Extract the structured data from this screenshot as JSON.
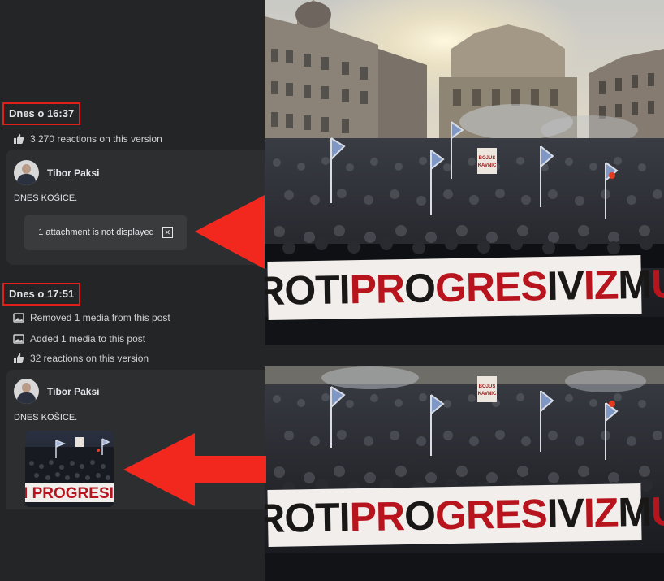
{
  "version1": {
    "timestamp": "Dnes o 16:37",
    "reactions_text": "3 270 reactions on this version",
    "author": "Tibor Paksi",
    "post_text": "DNES KOŠICE.",
    "attachment_notice": "1 attachment is not displayed"
  },
  "version2": {
    "timestamp": "Dnes o 17:51",
    "change_removed": "Removed 1 media from this post",
    "change_added": "Added 1 media to this post",
    "reactions_text": "32 reactions on this version",
    "author": "Tibor Paksi",
    "post_text": "DNES KOŠICE.",
    "thumbnail_banner": "TI PROGRESIV"
  },
  "photo": {
    "banner_text_dark_1": "PROTI ",
    "banner_text_red_1": "PR",
    "banner_text_dark_2": "O",
    "banner_text_red_2": "GRES",
    "banner_text_dark_3": "IV",
    "banner_text_red_3": "IZ",
    "banner_text_dark_4": "M",
    "banner_text_red_4": "U",
    "sign_text": "BOJUS\nKAVNIC\nTI"
  },
  "colors": {
    "highlight_red": "#e0201b",
    "arrow_red": "#f2281e",
    "panel_bg": "#242526",
    "card_bg": "#2d2e30",
    "banner_red": "#b7141e"
  }
}
